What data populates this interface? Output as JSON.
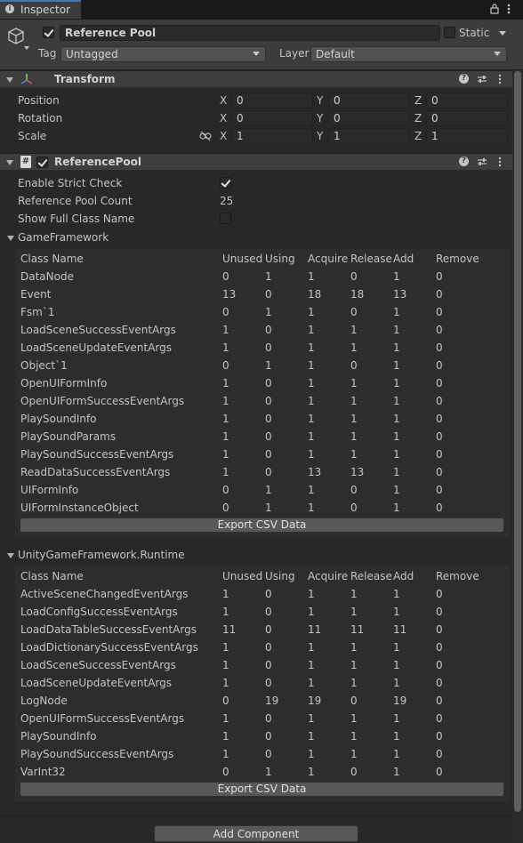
{
  "tab": {
    "label": "Inspector"
  },
  "header": {
    "object_name": "Reference Pool",
    "static_label": "Static",
    "tag_label": "Tag",
    "tag_value": "Untagged",
    "layer_label": "Layer",
    "layer_value": "Default"
  },
  "transform": {
    "title": "Transform",
    "rows": [
      {
        "label": "Position",
        "x": "0",
        "y": "0",
        "z": "0"
      },
      {
        "label": "Rotation",
        "x": "0",
        "y": "0",
        "z": "0"
      },
      {
        "label": "Scale",
        "x": "1",
        "y": "1",
        "z": "1"
      }
    ],
    "axis_x": "X",
    "axis_y": "Y",
    "axis_z": "Z"
  },
  "reference_pool": {
    "title": "ReferencePool",
    "enable_strict_check_label": "Enable Strict Check",
    "enable_strict_check": true,
    "reference_pool_count_label": "Reference Pool Count",
    "reference_pool_count": "25",
    "show_full_class_name_label": "Show Full Class Name",
    "show_full_class_name": false
  },
  "columns": [
    "Class Name",
    "Unused",
    "Using",
    "Acquire",
    "Release",
    "Add",
    "Remove"
  ],
  "groups": [
    {
      "name": "GameFramework",
      "rows": [
        [
          "DataNode",
          "0",
          "1",
          "1",
          "0",
          "1",
          "0"
        ],
        [
          "Event",
          "13",
          "0",
          "18",
          "18",
          "13",
          "0"
        ],
        [
          "Fsm`1",
          "0",
          "1",
          "1",
          "0",
          "1",
          "0"
        ],
        [
          "LoadSceneSuccessEventArgs",
          "1",
          "0",
          "1",
          "1",
          "1",
          "0"
        ],
        [
          "LoadSceneUpdateEventArgs",
          "1",
          "0",
          "1",
          "1",
          "1",
          "0"
        ],
        [
          "Object`1",
          "0",
          "1",
          "1",
          "0",
          "1",
          "0"
        ],
        [
          "OpenUIFormInfo",
          "1",
          "0",
          "1",
          "1",
          "1",
          "0"
        ],
        [
          "OpenUIFormSuccessEventArgs",
          "1",
          "0",
          "1",
          "1",
          "1",
          "0"
        ],
        [
          "PlaySoundInfo",
          "1",
          "0",
          "1",
          "1",
          "1",
          "0"
        ],
        [
          "PlaySoundParams",
          "1",
          "0",
          "1",
          "1",
          "1",
          "0"
        ],
        [
          "PlaySoundSuccessEventArgs",
          "1",
          "0",
          "1",
          "1",
          "1",
          "0"
        ],
        [
          "ReadDataSuccessEventArgs",
          "1",
          "0",
          "13",
          "13",
          "1",
          "0"
        ],
        [
          "UIFormInfo",
          "0",
          "1",
          "1",
          "0",
          "1",
          "0"
        ],
        [
          "UIFormInstanceObject",
          "0",
          "1",
          "1",
          "0",
          "1",
          "0"
        ]
      ],
      "export_label": "Export CSV Data"
    },
    {
      "name": "UnityGameFramework.Runtime",
      "rows": [
        [
          "ActiveSceneChangedEventArgs",
          "1",
          "0",
          "1",
          "1",
          "1",
          "0"
        ],
        [
          "LoadConfigSuccessEventArgs",
          "1",
          "0",
          "1",
          "1",
          "1",
          "0"
        ],
        [
          "LoadDataTableSuccessEventArgs",
          "11",
          "0",
          "11",
          "11",
          "11",
          "0"
        ],
        [
          "LoadDictionarySuccessEventArgs",
          "1",
          "0",
          "1",
          "1",
          "1",
          "0"
        ],
        [
          "LoadSceneSuccessEventArgs",
          "1",
          "0",
          "1",
          "1",
          "1",
          "0"
        ],
        [
          "LoadSceneUpdateEventArgs",
          "1",
          "0",
          "1",
          "1",
          "1",
          "0"
        ],
        [
          "LogNode",
          "0",
          "19",
          "19",
          "0",
          "19",
          "0"
        ],
        [
          "OpenUIFormSuccessEventArgs",
          "1",
          "0",
          "1",
          "1",
          "1",
          "0"
        ],
        [
          "PlaySoundInfo",
          "1",
          "0",
          "1",
          "1",
          "1",
          "0"
        ],
        [
          "PlaySoundSuccessEventArgs",
          "1",
          "0",
          "1",
          "1",
          "1",
          "0"
        ],
        [
          "VarInt32",
          "0",
          "1",
          "1",
          "0",
          "1",
          "0"
        ]
      ],
      "export_label": "Export CSV Data"
    }
  ],
  "add_component_label": "Add Component",
  "colors": {
    "accent": "#3a79bb",
    "background": "#282828",
    "panel": "#3c3c3c"
  }
}
